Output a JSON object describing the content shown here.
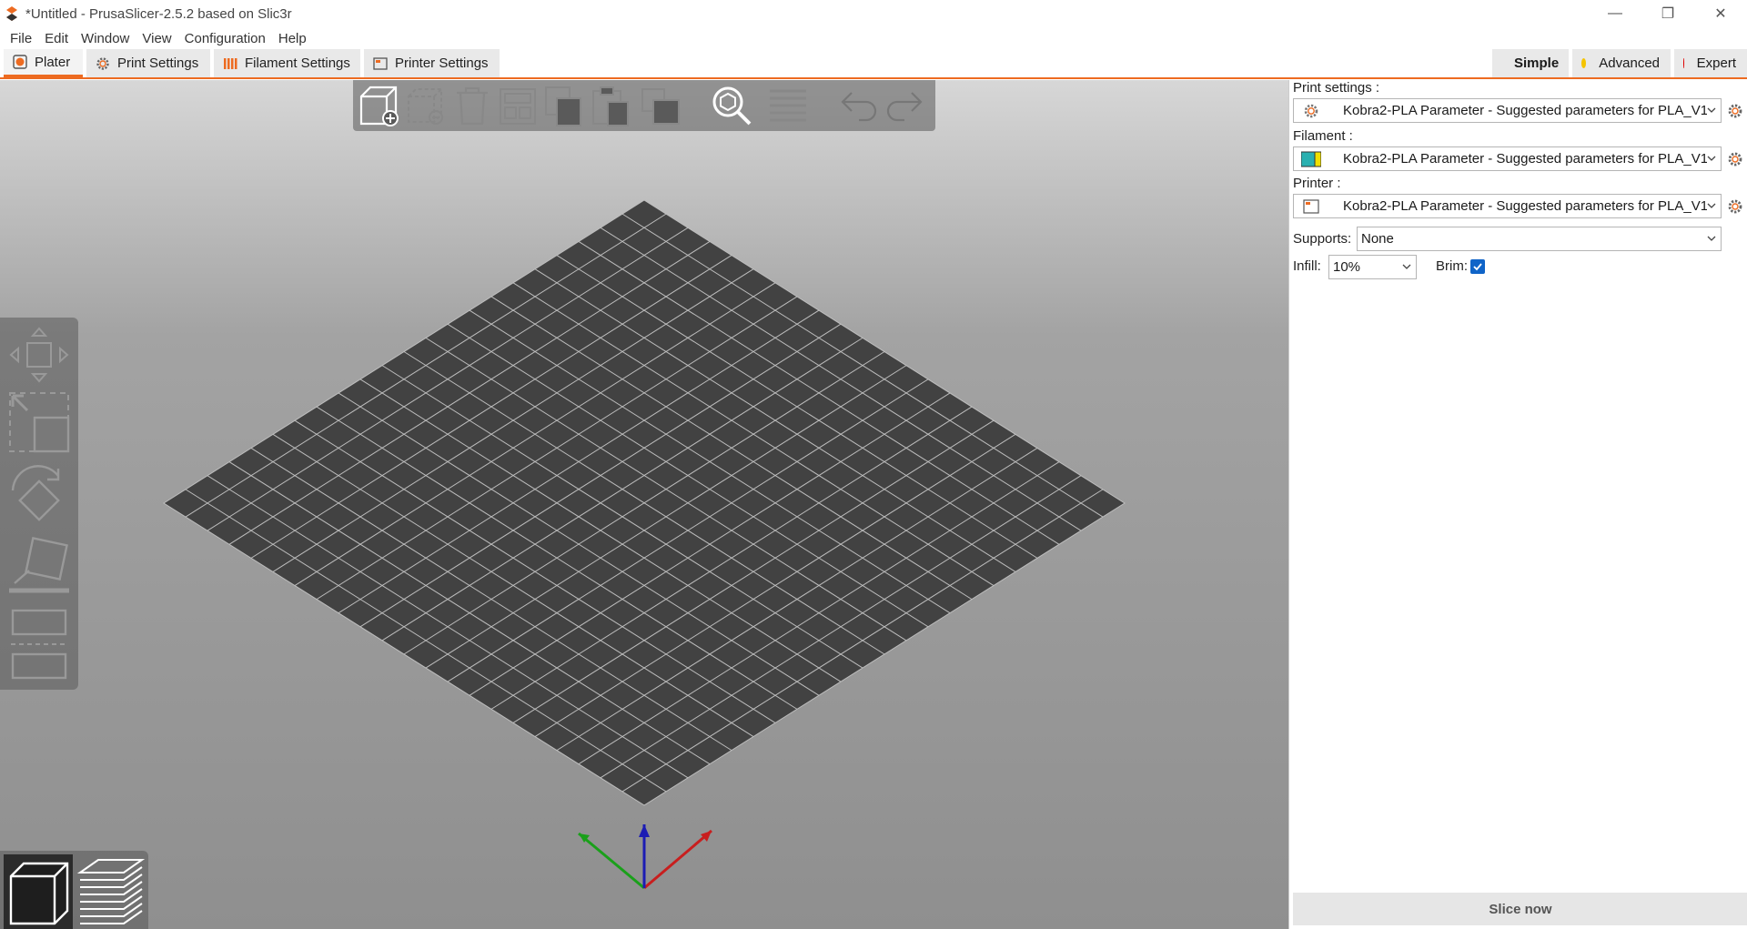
{
  "window": {
    "title": "*Untitled - PrusaSlicer-2.5.2 based on Slic3r",
    "minimize_glyph": "—",
    "restore_glyph": "❐",
    "close_glyph": "✕"
  },
  "menu": [
    "File",
    "Edit",
    "Window",
    "View",
    "Configuration",
    "Help"
  ],
  "tabs": [
    {
      "label": "Plater",
      "icon": "plater-icon",
      "active": true
    },
    {
      "label": "Print Settings",
      "icon": "cog-icon",
      "active": false
    },
    {
      "label": "Filament Settings",
      "icon": "spool-icon",
      "active": false
    },
    {
      "label": "Printer Settings",
      "icon": "printer-icon",
      "active": false
    }
  ],
  "modes": [
    {
      "label": "Simple",
      "color": "#2ec52e",
      "active": true
    },
    {
      "label": "Advanced",
      "color": "#f5c400",
      "active": false
    },
    {
      "label": "Expert",
      "color": "#e00000",
      "active": false
    }
  ],
  "sidebar": {
    "print_label": "Print settings :",
    "print_value": "Kobra2-PLA Parameter - Suggested parameters for PLA_V1",
    "filament_label": "Filament :",
    "filament_value": "Kobra2-PLA Parameter - Suggested parameters for PLA_V1",
    "filament_color": "#29b0b0",
    "printer_label": "Printer :",
    "printer_value": "Kobra2-PLA Parameter - Suggested parameters for PLA_V1",
    "supports_label": "Supports:",
    "supports_value": "None",
    "infill_label": "Infill:",
    "infill_value": "10%",
    "brim_label": "Brim:",
    "brim_checked": true,
    "slice_label": "Slice now"
  },
  "colors": {
    "accent": "#ed6b21",
    "bed": "#424242",
    "bed_grid": "#bdbdbd",
    "checkbox": "#0f64c8"
  }
}
